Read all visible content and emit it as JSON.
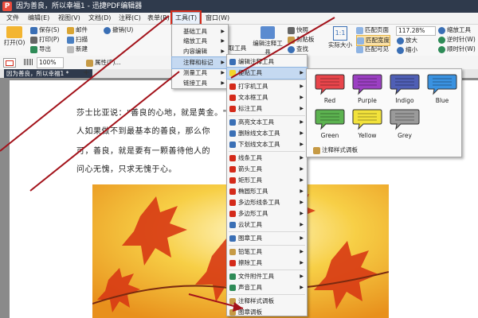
{
  "app": {
    "title": "因为善良，所以幸福1 - 迅捷PDF编辑器",
    "logo_letter": "P"
  },
  "menubar": [
    {
      "label": "文件"
    },
    {
      "label": "编辑(E)"
    },
    {
      "label": "视图(V)"
    },
    {
      "label": "文档(D)"
    },
    {
      "label": "注释(C)"
    },
    {
      "label": "表单(R)"
    },
    {
      "label": "工具(T)"
    },
    {
      "label": "窗口(W)"
    }
  ],
  "ribbon": {
    "open": "打开(O)",
    "save": "保存(S)",
    "print": "打印(P)",
    "export": "导出",
    "email": "邮件",
    "scan": "扫描",
    "new": "新建",
    "undo": "撤销(U)",
    "text_tool": "取工具",
    "annot_tool": "编辑注释工具",
    "snapshot": "快照",
    "clipboard": "剪贴板",
    "find": "查找",
    "actual_size": "实际大小",
    "fit_page": "匹配页面",
    "fit_width": "匹配宽度",
    "fit_visible": "匹配可见",
    "zoom_value": "117.28%",
    "zoom_in": "放大",
    "zoom_out": "缩小",
    "zoom_tool": "缩放工具",
    "rotate_cw": "顺时针(W)",
    "rotate_ccw": "逆时针(W)"
  },
  "fmtbar": {
    "zoom": "100%",
    "properties": "属性(P)..."
  },
  "tab": {
    "label": "因为善良，所以幸福1 *",
    "add": "+"
  },
  "document": {
    "lines": [
      "莎士比亚说：\"善良的心地，就是黄金。\"",
      "人如果做不到最基本的善良，那么你",
      "可，善良，就是要有一颗善待他人的",
      "问心无愧，只求无愧于心。"
    ]
  },
  "tools_menu": [
    {
      "label": "基础工具"
    },
    {
      "label": "缩放工具"
    },
    {
      "label": "内容编辑"
    },
    {
      "label": "注释和标记"
    },
    {
      "label": "测量工具"
    },
    {
      "label": "链接工具"
    }
  ],
  "annot_menu": [
    {
      "label": "编辑注释工具"
    },
    {
      "label": "便贴工具"
    },
    {
      "label": "打字机工具"
    },
    {
      "label": "文本框工具"
    },
    {
      "label": "标注工具"
    },
    {
      "label": "高亮文本工具"
    },
    {
      "label": "删除线文本工具"
    },
    {
      "label": "下划线文本工具"
    },
    {
      "label": "线条工具"
    },
    {
      "label": "箭头工具"
    },
    {
      "label": "矩形工具"
    },
    {
      "label": "椭圆形工具"
    },
    {
      "label": "多边形线条工具"
    },
    {
      "label": "多边形工具"
    },
    {
      "label": "云状工具"
    },
    {
      "label": "图章工具"
    },
    {
      "label": "铅笔工具"
    },
    {
      "label": "擦除工具"
    },
    {
      "label": "文件附件工具"
    },
    {
      "label": "声音工具"
    },
    {
      "label": "注释样式调板"
    },
    {
      "label": "图章调板"
    }
  ],
  "sticky_palette": {
    "colors": [
      {
        "name": "Red",
        "color": "#e8454b"
      },
      {
        "name": "Purple",
        "color": "#9b3fc2"
      },
      {
        "name": "Indigo",
        "color": "#4f5fb5"
      },
      {
        "name": "Blue",
        "color": "#3a92e0"
      },
      {
        "name": "Green",
        "color": "#5cb350"
      },
      {
        "name": "Yellow",
        "color": "#f2e23b"
      },
      {
        "name": "Grey",
        "color": "#9a9a9a"
      }
    ],
    "footer": "注释样式调板"
  },
  "colors": {
    "titlebar": "#2f3a4c",
    "highlight": "#c5d9f1",
    "annotation_red": "#c0141a"
  }
}
